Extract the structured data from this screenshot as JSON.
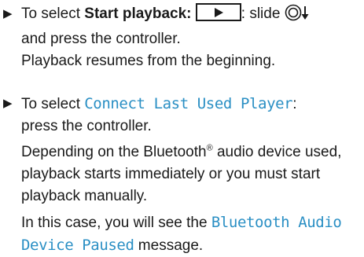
{
  "item1": {
    "bullet_icon": "triangle-bullet-icon",
    "prefix": "To select ",
    "bold_label": "Start playback:",
    "button_icon": "play-icon",
    "after_button": ": slide ",
    "controller_icon": "controller-slide-down-icon",
    "line2": "and press the controller.",
    "line3": "Playback resumes from the beginning."
  },
  "item2": {
    "bullet_icon": "triangle-bullet-icon",
    "prefix": "To select ",
    "display_label": "Connect Last Used Player",
    "suffix": ":",
    "line2": "press the controller.",
    "para2_a": "Depending on the Bluetooth",
    "registered_mark": "®",
    "para2_b": " audio device used, playback starts immediately or you must start playback manually.",
    "para3_prefix": "In this case, you will see the ",
    "display_message": "Bluetooth Audio Device Paused",
    "para3_suffix": " message."
  }
}
